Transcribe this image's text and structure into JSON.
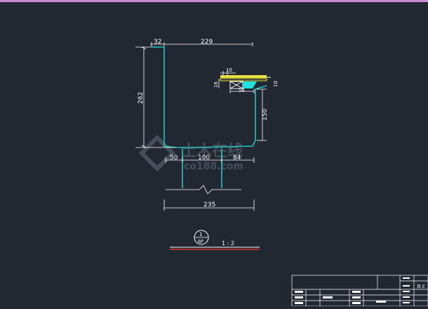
{
  "colors": {
    "background": "#222832",
    "top_border": "#c98ad6",
    "profile": "#20c4c4",
    "dimension": "#ffffff",
    "yellow": "#e8e040",
    "cyan_fill": "#20e0e0",
    "red": "#e03030"
  },
  "dimensions": {
    "d32": "32",
    "d229": "229",
    "d262": "262",
    "d10": "10",
    "d16": "16",
    "d56": "56",
    "d150": "150",
    "d50": "50",
    "d100": "100",
    "d84": "84",
    "d235": "235",
    "d_small": "10"
  },
  "section_mark": {
    "number": "1",
    "sheet": "BP"
  },
  "scale_label": "1 : 2",
  "watermark": {
    "cn": "土木在线",
    "en": "co188.com"
  },
  "title_block": {
    "cell_label": "风 E"
  }
}
